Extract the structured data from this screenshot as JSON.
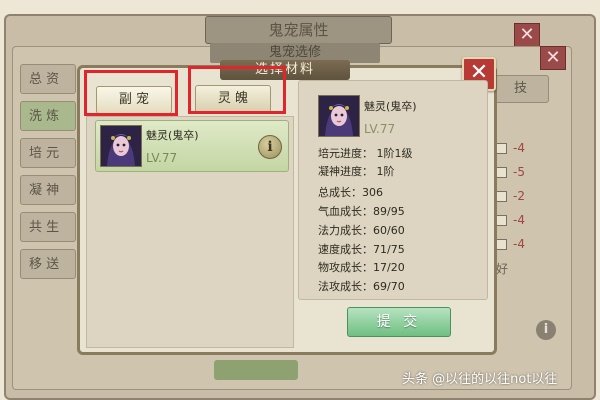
{
  "background": {
    "title": "鬼宠属性",
    "sub_title": "鬼宠选修",
    "close_label": "✕",
    "tabs": [
      "总 资",
      "洗 炼",
      "培 元",
      "凝 神",
      "共 生",
      "移 送"
    ],
    "active_tab_index": 1,
    "right_button": "技",
    "stat_values": [
      "-4",
      "-5",
      "-2",
      "-4",
      "-4"
    ],
    "char": "好",
    "info_label": "i"
  },
  "dialog": {
    "title": "选择材料",
    "close_label": "✕",
    "tabs": [
      {
        "label": "副 宠",
        "selected": true
      },
      {
        "label": "灵 魄",
        "selected": false
      }
    ],
    "pet": {
      "name": "魅灵(鬼卒)",
      "level": "LV.77",
      "info_label": "i"
    },
    "detail": {
      "name": "魅灵(鬼卒)",
      "level": "LV.77",
      "lines": [
        "培元进度： 1阶1级",
        "凝神进度： 1阶",
        "总成长：306",
        "气血成长：89/95",
        "法力成长：60/60",
        "速度成长：71/75",
        "物攻成长：17/20",
        "法攻成长：69/70"
      ]
    },
    "submit_label": "提 交"
  },
  "colors": {
    "highlight": "#e0262a",
    "close_red": "#b73a35",
    "submit_green": "#6fbf82",
    "pet_card_green": "#c4d6a4"
  },
  "watermark": "头条 @以往的以往not以往"
}
